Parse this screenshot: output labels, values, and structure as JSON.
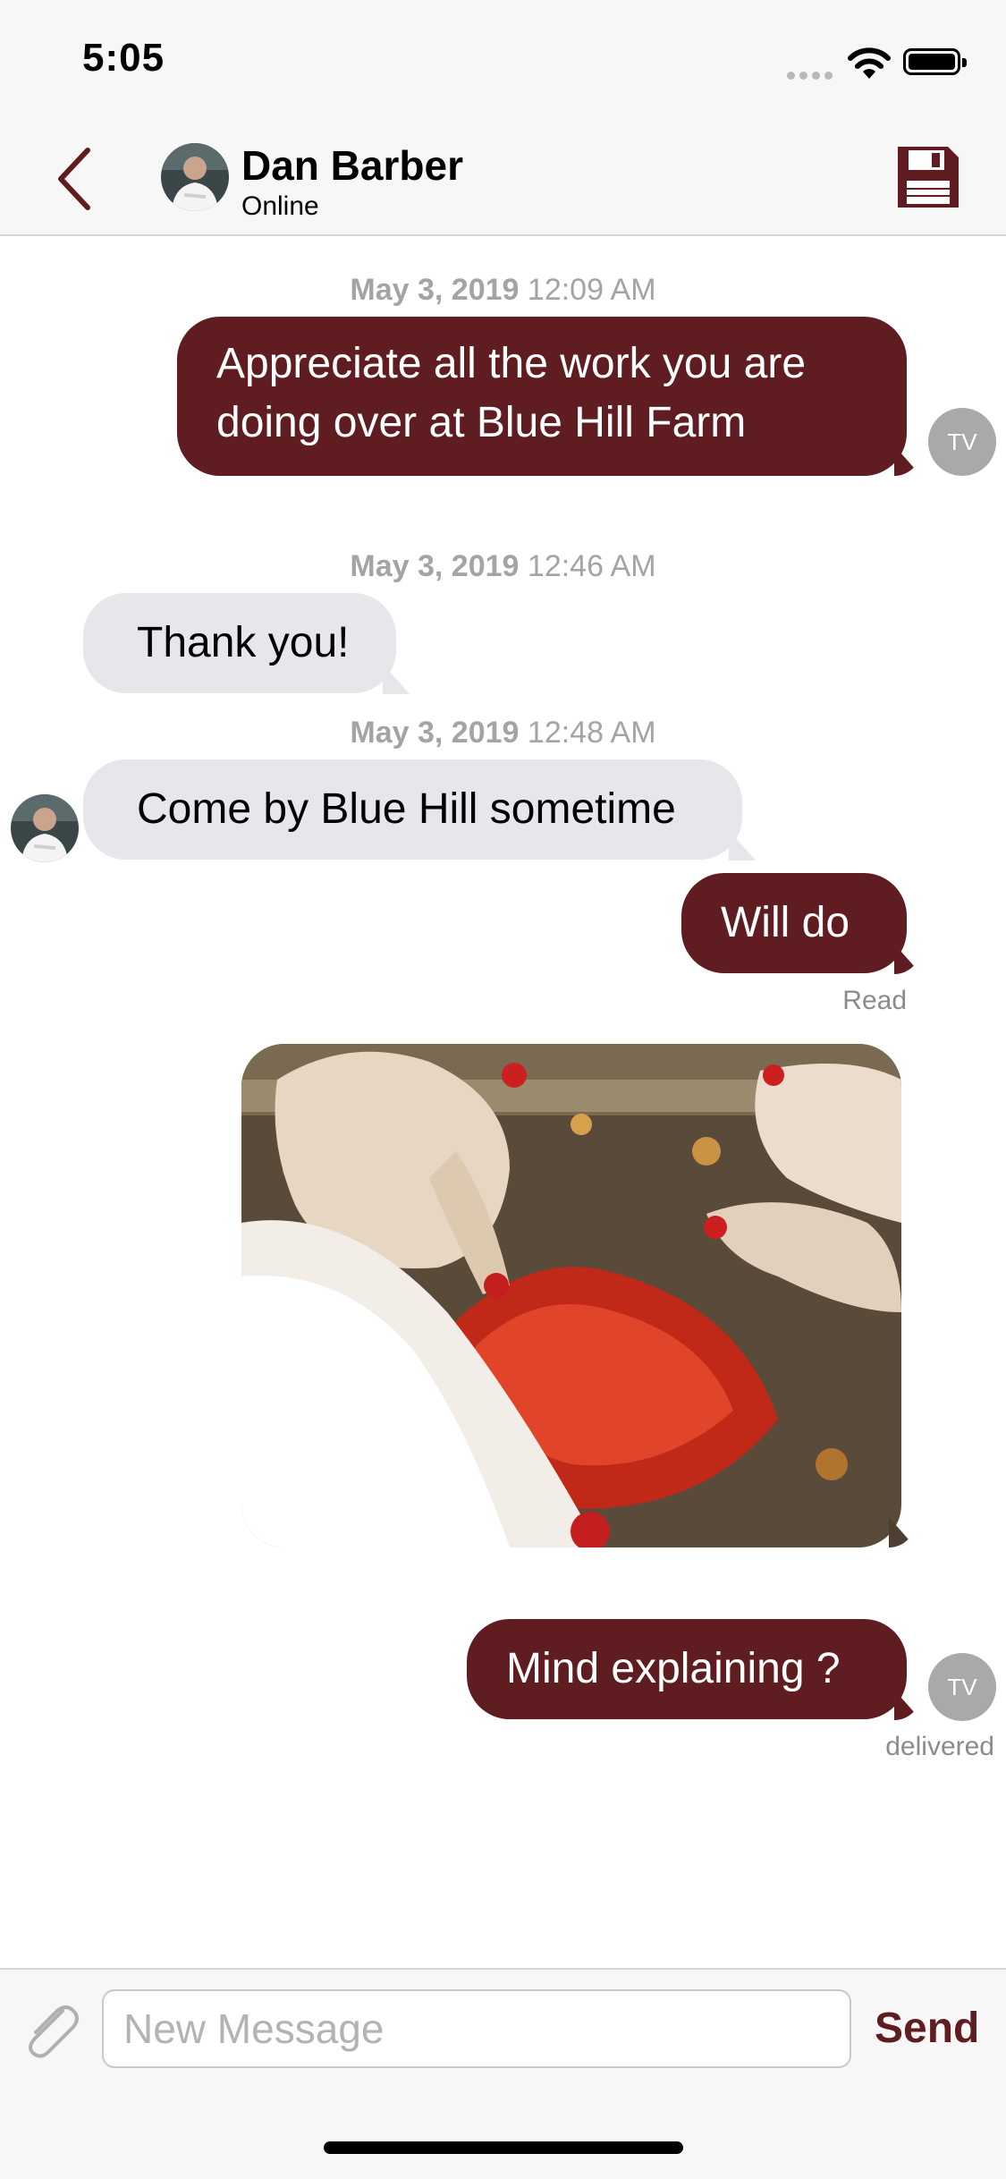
{
  "status_bar": {
    "time": "5:05"
  },
  "header": {
    "contact_name": "Dan Barber",
    "contact_status": "Online"
  },
  "messages": [
    {
      "date": "May 3, 2019",
      "time": "12:09 AM",
      "text": "Appreciate all the work you are doing over at Blue Hill Farm",
      "direction": "outgoing",
      "avatar_initials": "TV"
    },
    {
      "date": "May 3, 2019",
      "time": "12:46 AM",
      "text": "Thank you!",
      "direction": "incoming"
    },
    {
      "date": "May 3, 2019",
      "time": "12:48 AM",
      "text": "Come by Blue Hill sometime",
      "direction": "incoming"
    },
    {
      "text": "Will do",
      "direction": "outgoing",
      "status": "Read"
    },
    {
      "type": "image",
      "direction": "outgoing"
    },
    {
      "text": "Mind explaining ?",
      "direction": "outgoing",
      "avatar_initials": "TV",
      "status": "delivered"
    }
  ],
  "composer": {
    "placeholder": "New Message",
    "send_label": "Send"
  },
  "colors": {
    "accent": "#5f1d21",
    "incoming_bubble": "#e6e6eb",
    "timestamp": "#a4a4a4",
    "avatar_gray": "#a9a9a9"
  },
  "icons": [
    "back-chevron-icon",
    "save-floppy-icon",
    "paperclip-icon",
    "wifi-icon",
    "battery-icon",
    "signal-icon"
  ]
}
